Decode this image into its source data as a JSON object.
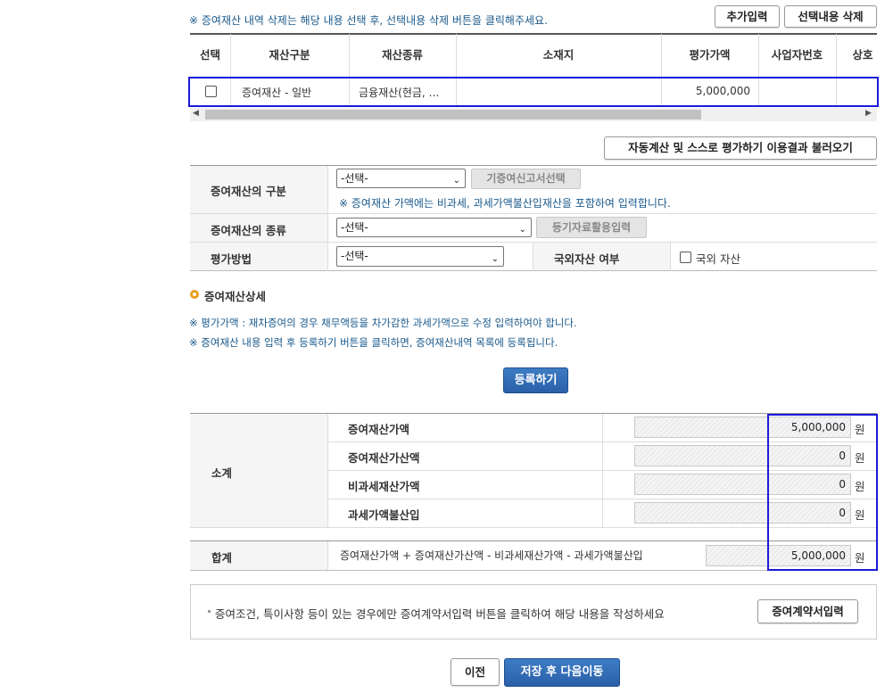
{
  "top_note": "※ 증여재산 내역 삭제는 해당 내용 선택 후, 선택내용 삭제 버튼을  클릭해주세요.",
  "buttons": {
    "add": "추가입력",
    "delete_selected": "선택내용 삭제",
    "load_auto_calc": "자동계산 및 스스로 평가하기 이용결과 불러오기",
    "prior_return": "기증여신고서선택",
    "registry_data": "등기자료활용입력",
    "register": "등록하기",
    "contract_input": "증여계약서입력",
    "prev": "이전",
    "save_next": "저장 후 다음이동"
  },
  "table": {
    "headers": [
      "선택",
      "재산구분",
      "재산종류",
      "소재지",
      "평가가액",
      "사업자번호",
      "상호"
    ],
    "rows": [
      {
        "category": "증여재산 - 일반",
        "type": "금융재산(현금, …",
        "location": "",
        "value": "5,000,000",
        "biz_no": "",
        "company": ""
      }
    ]
  },
  "form": {
    "category_label": "증여재산의 구분",
    "category_value": "-선택-",
    "category_note": "※ 증여재산 가액에는 비과세, 과세가액불산입재산을 포함하여 입력합니다.",
    "type_label": "증여재산의 종류",
    "type_value": "-선택-",
    "method_label": "평가방법",
    "method_value": "-선택-",
    "foreign_label": "국외자산 여부",
    "foreign_checkbox": "국외 자산"
  },
  "detail": {
    "title": "증여재산상세",
    "note1": "※ 평가가액 : 재차증여의 경우 채무액등을 차가감한 과세가액으로 수정 입력하여야 합니다.",
    "note2": "※ 증여재산 내용 입력 후 등록하기 버튼을 클릭하면, 증여재산내역 목록에 등록됩니다."
  },
  "summary": {
    "subtotal_label": "소계",
    "rows": [
      {
        "label": "증여재산가액",
        "value": "5,000,000",
        "unit": "원"
      },
      {
        "label": "증여재산가산액",
        "value": "0",
        "unit": "원"
      },
      {
        "label": "비과세재산가액",
        "value": "0",
        "unit": "원"
      },
      {
        "label": "과세가액불산입",
        "value": "0",
        "unit": "원"
      }
    ],
    "total_label": "합계",
    "total_formula": "증여재산가액 + 증여재산가산액 - 비과세재산가액 - 과세가액불산입",
    "total_value": "5,000,000",
    "total_unit": "원"
  },
  "contract_note": "증여조건, 특이사항 등이 있는 경우에만 증여계약서입력 버튼을 클릭하여 해당 내용을 작성하세요"
}
